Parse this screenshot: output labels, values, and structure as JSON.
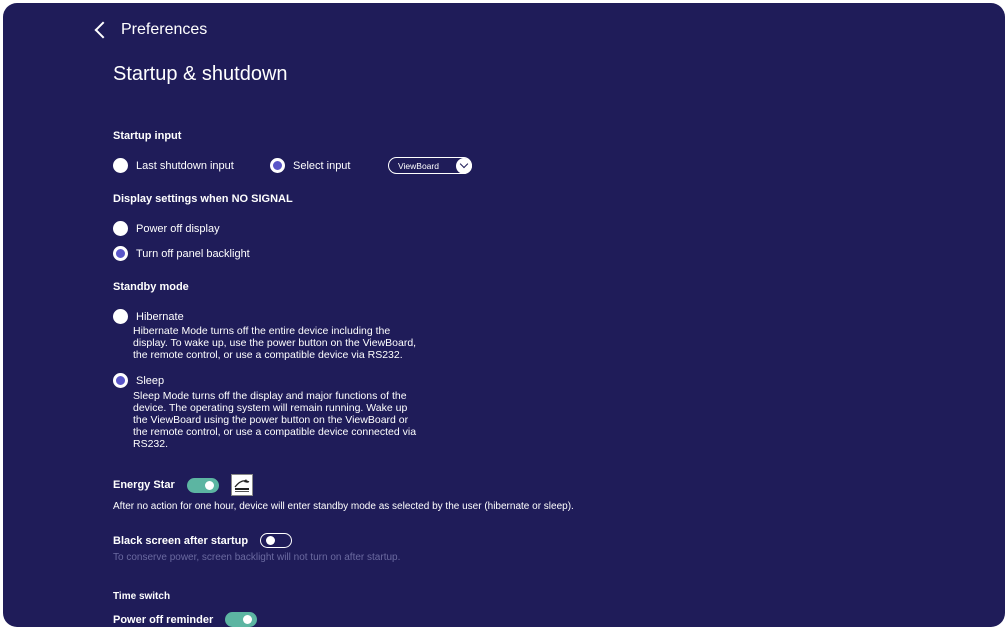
{
  "header": {
    "back_label": "Preferences",
    "title": "Startup & shutdown"
  },
  "startup_input": {
    "heading": "Startup input",
    "options": [
      {
        "label": "Last shutdown input",
        "selected": false
      },
      {
        "label": "Select input",
        "selected": true
      }
    ],
    "dropdown_value": "ViewBoard"
  },
  "no_signal": {
    "heading": "Display settings when NO SIGNAL",
    "options": [
      {
        "label": "Power off display",
        "selected": false
      },
      {
        "label": "Turn off panel backlight",
        "selected": true
      }
    ]
  },
  "standby": {
    "heading": "Standby mode",
    "hibernate": {
      "label": "Hibernate",
      "selected": false,
      "description": "Hibernate Mode turns off the entire device including the display. To wake up, use the power button on the ViewBoard, the remote control, or use a compatible device via RS232."
    },
    "sleep": {
      "label": "Sleep",
      "selected": true,
      "description": "Sleep Mode turns off the display and major functions of the device. The operating system will remain running. Wake up the ViewBoard using the power button on the ViewBoard or the remote control, or use a compatible device connected via RS232."
    }
  },
  "energy_star": {
    "label": "Energy Star",
    "enabled": true,
    "logo_icon": "energy-star-logo",
    "note": "After no action for one hour, device will enter standby mode as selected by the user (hibernate or sleep)."
  },
  "black_screen": {
    "label": "Black screen after startup",
    "enabled": false,
    "note": "To conserve power, screen backlight will not turn on after startup."
  },
  "time_switch": {
    "heading": "Time switch",
    "power_off_reminder_label": "Power off reminder",
    "power_off_reminder_enabled": true
  },
  "colors": {
    "background": "#1f1c59",
    "accent": "#5a56c8",
    "toggle_on": "#5cb5a2"
  }
}
